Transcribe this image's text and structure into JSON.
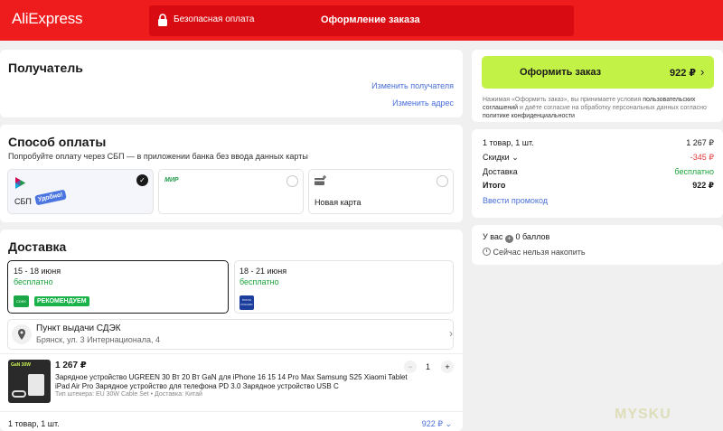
{
  "header": {
    "logo": "AliExpress",
    "secure_payment": "Безопасная оплата",
    "checkout_title": "Оформление заказа"
  },
  "recipient": {
    "title": "Получатель",
    "change_recipient": "Изменить получателя",
    "change_address": "Изменить адрес"
  },
  "payment": {
    "title": "Способ оплаты",
    "hint": "Попробуйте оплату через СБП — в приложении банка без ввода данных карты",
    "options": [
      {
        "label": "СБП",
        "badge": "Удобно!",
        "selected": true
      },
      {
        "label": "",
        "logo": "МИР",
        "selected": false
      },
      {
        "label": "Новая карта",
        "selected": false
      }
    ]
  },
  "delivery": {
    "title": "Доставка",
    "options": [
      {
        "dates": "15 - 18 июня",
        "price": "бесплатно",
        "carrier": "CDEK",
        "tag": "РЕКОМЕНДУЕМ"
      },
      {
        "dates": "18 - 21 июня",
        "price": "бесплатно",
        "carrier": "ПОЧТА РОССИИ"
      }
    ],
    "pickup_title": "Пункт выдачи СДЭК",
    "pickup_address": "Брянск, ул. 3 Интернационала, 4"
  },
  "product": {
    "price": "1 267 ₽",
    "name_line1": "Зарядное устройство UGREEN 30 Вт 20 Вт GaN для iPhone 16 15 14 Pro Max Samsung S25 Xiaomi Tablet",
    "name_line2": "iPad Air Pro Зарядное устройство для телефона PD 3.0 Зарядное устройство USB C",
    "meta": "Тип штекера: EU 30W Cable Set • Доставка: Китай",
    "qty": "1",
    "minus": "−",
    "plus": "+",
    "thumb_text": "GaN 30W"
  },
  "footer": {
    "count": "1 товар, 1 шт.",
    "total": "922 ₽"
  },
  "summary": {
    "order_button": "Оформить заказ",
    "order_price": "922 ₽",
    "terms_prefix": "Нажимая «Оформить заказ», вы принимаете условия",
    "terms_link1": "пользовательских соглашений",
    "terms_mid": "и даёте согласие на обработку персональных данных",
    "terms_text": "согласно",
    "terms_link2": "политике конфиденциальности",
    "items_label": "1 товар, 1 шт.",
    "items_value": "1 267 ₽",
    "discount_label": "Скидки",
    "discount_value": "-345 ₽",
    "shipping_label": "Доставка",
    "shipping_value": "бесплатно",
    "total_label": "Итого",
    "total_value": "922 ₽",
    "promo_link": "Ввести промокод"
  },
  "points": {
    "you_have": "У вас",
    "points_value": "0 баллов",
    "cannot_earn": "Сейчас нельзя накопить"
  },
  "watermark": "MYSKU",
  "colors": {
    "brand_red": "#ee1c1c",
    "order_green": "#c3f246",
    "link_blue": "#4a6fd8",
    "success_green": "#1aa33a",
    "discount_red": "#e33a3a"
  }
}
